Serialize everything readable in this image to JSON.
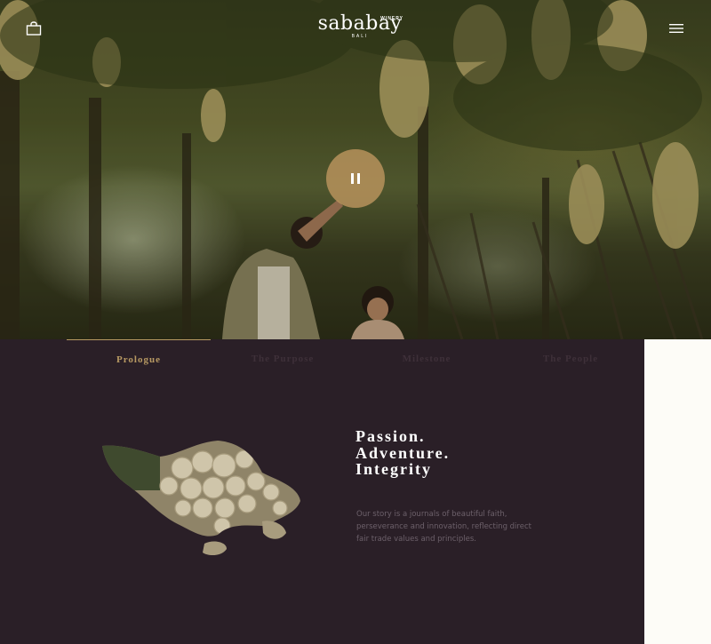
{
  "header": {
    "logo_text": "sababay",
    "logo_tag": "WINERY",
    "logo_sub": "BALI",
    "bag_icon": "shopping-bag-icon",
    "menu_icon": "hamburger-menu-icon"
  },
  "hero": {
    "video_state": "playing",
    "control_icon": "pause-icon"
  },
  "tabs": [
    {
      "label": "Prologue",
      "active": true
    },
    {
      "label": "The Purpose",
      "active": false
    },
    {
      "label": "Milestone",
      "active": false
    },
    {
      "label": "The People",
      "active": false
    }
  ],
  "section": {
    "headline_lines": [
      "Passion.",
      "Adventure.",
      "Integrity"
    ],
    "story": "Our story is a journals of beautiful faith, perseverance and innovation, reflecting direct fair trade values and principles."
  },
  "colors": {
    "background": "#2a1f27",
    "accent": "#b89a63",
    "side_panel": "#fdfcf7",
    "play_button": "#be965f"
  }
}
